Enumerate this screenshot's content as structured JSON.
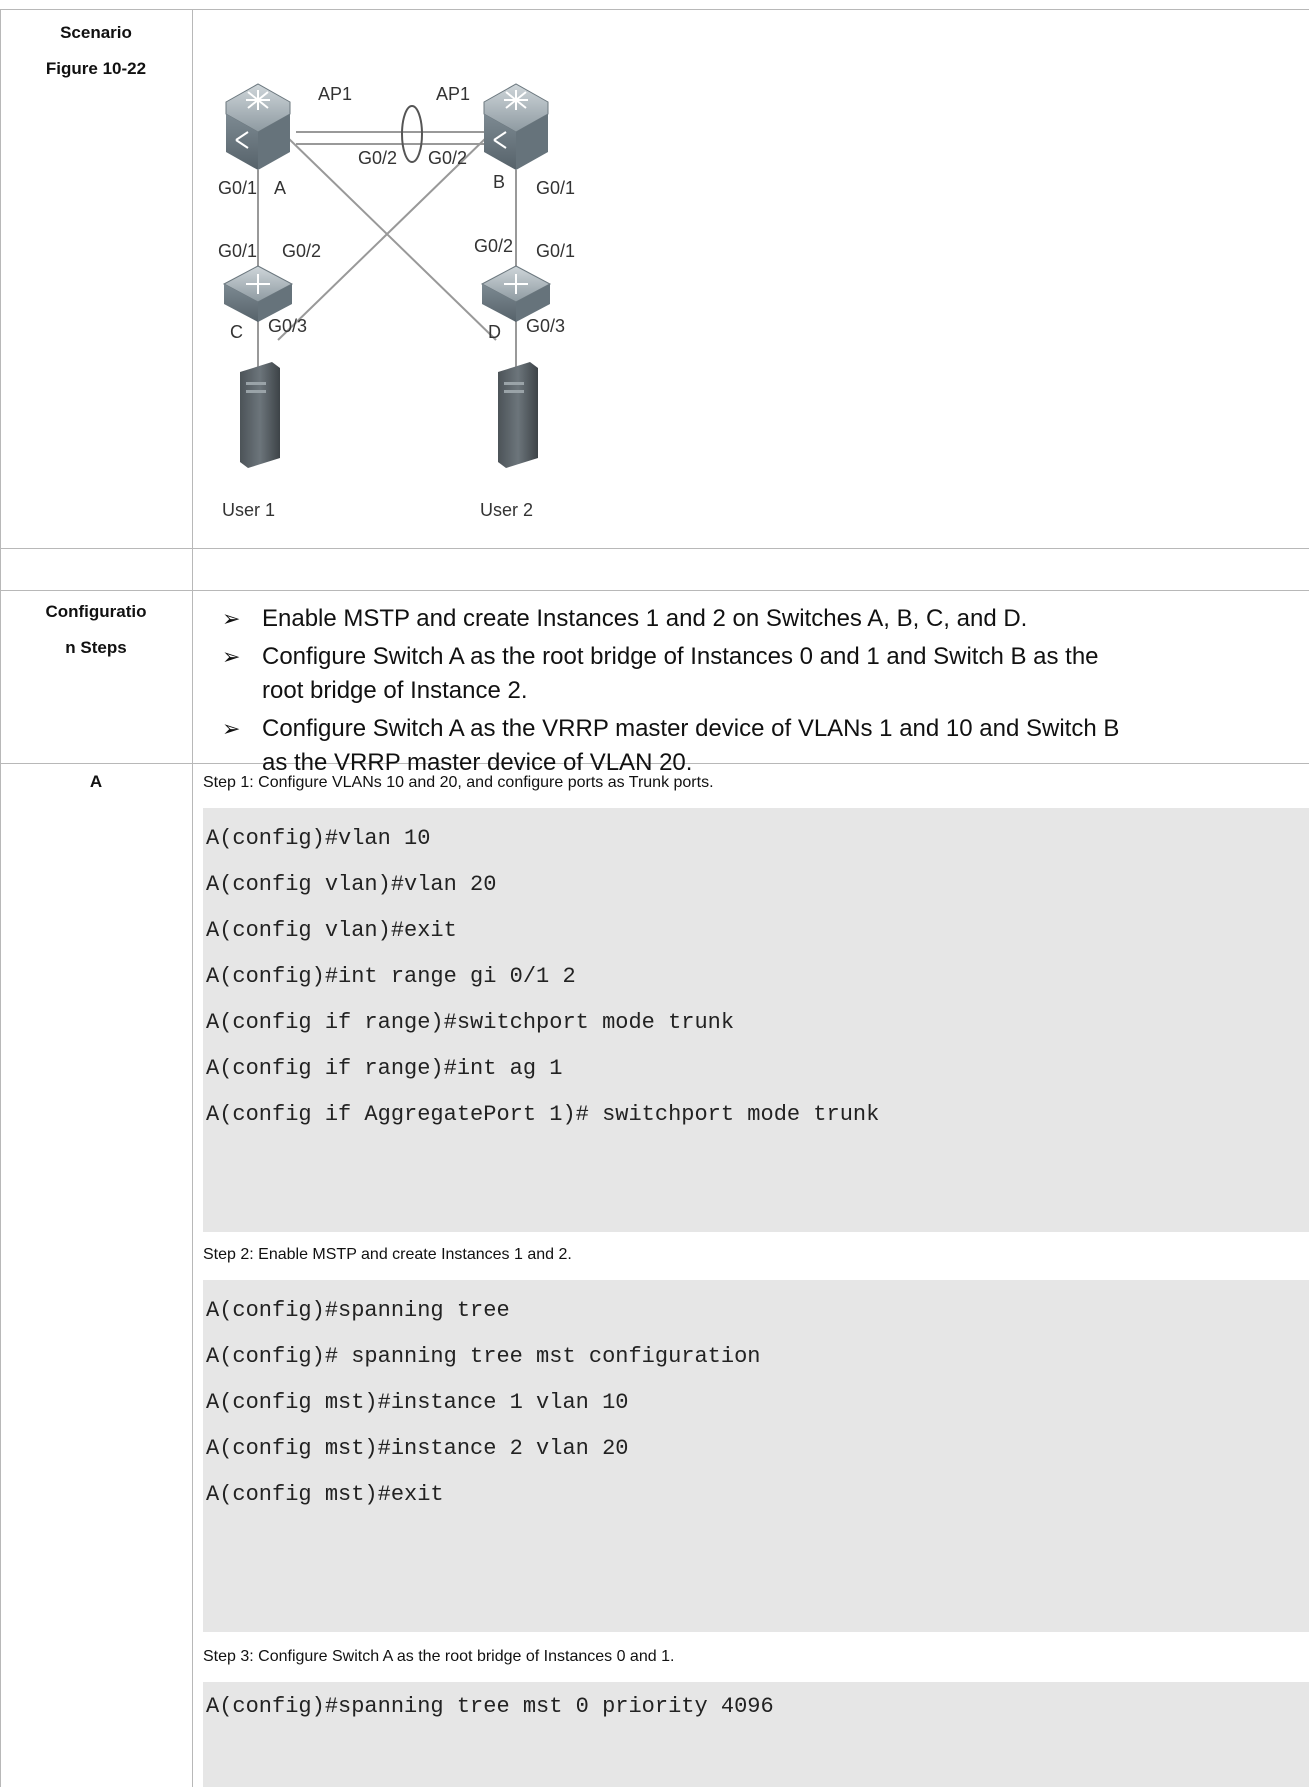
{
  "rows": {
    "scenario": {
      "label_line1": "Scenario",
      "label_line2": "Figure 10-22"
    },
    "config": {
      "label_line1": "Configuratio",
      "label_line2": "n Steps"
    },
    "a": {
      "label": "A"
    }
  },
  "figure": {
    "ap1_left": "AP1",
    "ap1_right": "AP1",
    "a_g02": "G0/2",
    "b_g02": "G0/2",
    "a_g01": "G0/1",
    "switch_a": "A",
    "switch_b": "B",
    "b_g01": "G0/1",
    "c_g01": "G0/1",
    "c_g02": "G0/2",
    "d_g02": "G0/2",
    "d_g01": "G0/1",
    "switch_c": "C",
    "c_g03": "G0/3",
    "switch_d": "D",
    "d_g03": "G0/3",
    "user1": "User 1",
    "user2": "User 2"
  },
  "bullets": [
    {
      "line1": "Enable MSTP and create Instances 1 and 2 on Switches A, B, C, and D.",
      "line2": ""
    },
    {
      "line1": "Configure Switch A as the root bridge of Instances 0 and 1 and Switch B as the",
      "line2": "root bridge of Instance 2."
    },
    {
      "line1": "Configure Switch A as the VRRP master device of VLANs 1 and 10 and Switch B",
      "line2": "as the VRRP master device of VLAN 20."
    }
  ],
  "bullet_glyph": "➢",
  "steps": [
    {
      "title": "Step 1: Configure VLANs 10 and 20, and configure ports as Trunk ports.",
      "lines": [
        "A(config)#vlan 10",
        "A(config vlan)#vlan 20",
        "A(config vlan)#exit",
        "A(config)#int range gi 0/1 2",
        "A(config if range)#switchport mode trunk",
        "A(config if range)#int ag 1",
        "A(config if AggregatePort 1)# switchport mode trunk"
      ]
    },
    {
      "title": "Step 2: Enable MSTP and create Instances 1 and 2.",
      "lines": [
        "A(config)#spanning tree",
        "A(config)# spanning tree mst configuration",
        "A(config mst)#instance 1 vlan 10",
        "A(config mst)#instance 2 vlan 20",
        "A(config mst)#exit"
      ]
    },
    {
      "title": "Step 3: Configure Switch A as the root bridge of Instances 0 and 1.",
      "lines": [
        "A(config)#spanning tree mst 0 priority 4096"
      ]
    }
  ]
}
